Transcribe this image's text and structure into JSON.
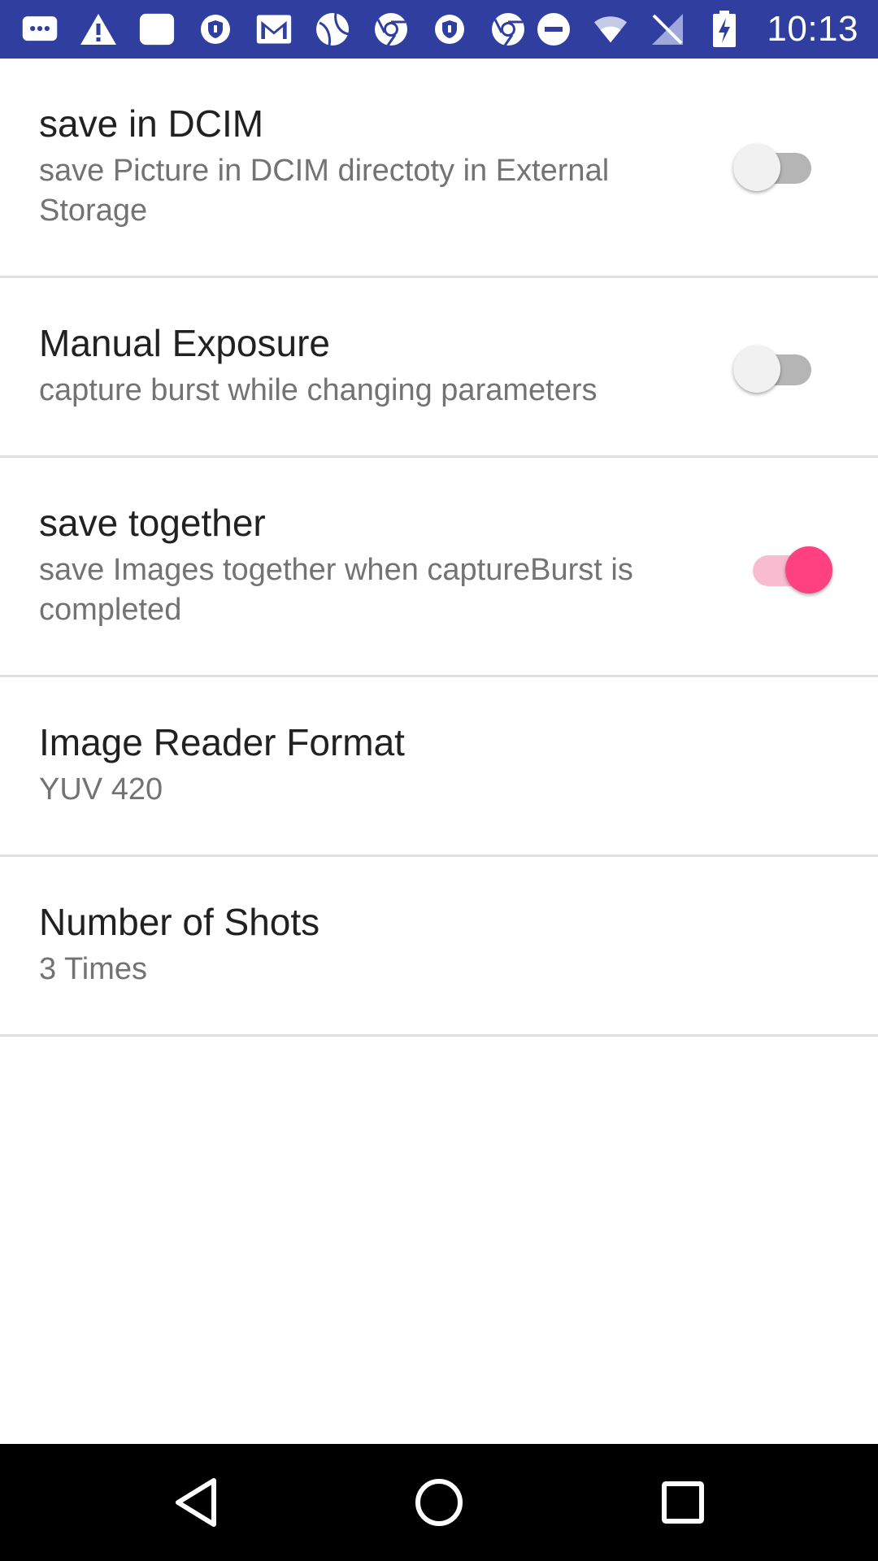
{
  "status_bar": {
    "time": "10:13",
    "left_icons": [
      "message-icon",
      "warning-icon",
      "note-icon",
      "vpn-icon",
      "gmail-icon",
      "sports-icon",
      "chrome-icon",
      "vpn-icon",
      "chrome-icon"
    ],
    "right_icons": [
      "do-not-disturb-icon",
      "wifi-icon",
      "no-signal-icon",
      "battery-charging-icon"
    ],
    "background_color": "#303f9f"
  },
  "preferences": [
    {
      "title": "save in DCIM",
      "summary": "save Picture in DCIM directoty in External Storage",
      "switch": "off"
    },
    {
      "title": "Manual Exposure",
      "summary": "capture burst while changing parameters",
      "switch": "off"
    },
    {
      "title": "save together",
      "summary": "save Images together when captureBurst is completed",
      "switch": "on"
    },
    {
      "title": "Image Reader Format",
      "summary": "YUV 420"
    },
    {
      "title": "Number of Shots",
      "summary": "3 Times"
    }
  ],
  "accent_color": "#ff4081",
  "nav_bar": {
    "buttons": [
      "back-icon",
      "home-icon",
      "recents-icon"
    ]
  }
}
